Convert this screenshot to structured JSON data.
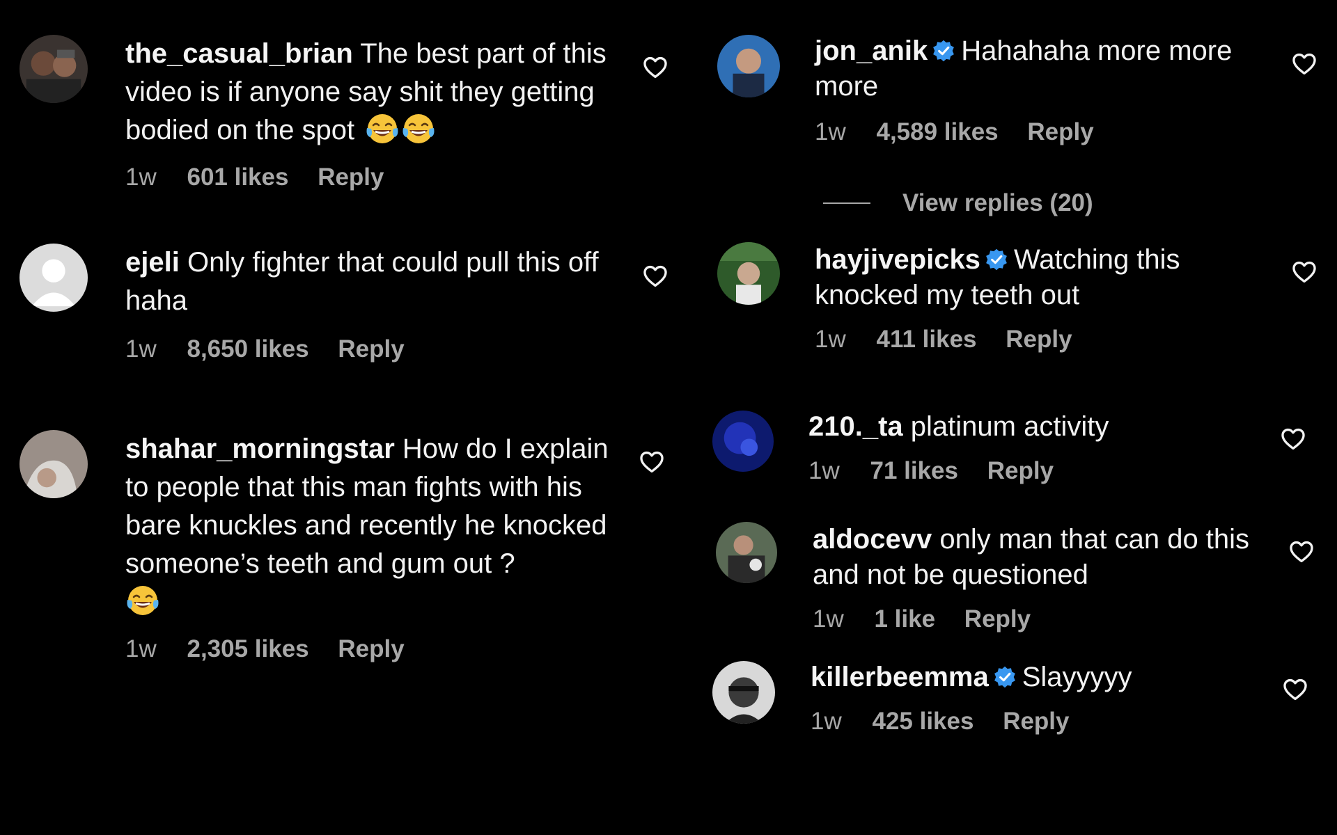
{
  "colors": {
    "background": "#000000",
    "text": "#f2f2f2",
    "meta": "#a8a8a8",
    "verified": "#3897f0"
  },
  "icons": {
    "like": "heart-outline-icon",
    "verified": "verified-badge-icon",
    "emoji": "face-with-tears-of-joy"
  },
  "comments": [
    {
      "username": "the_casual_brian",
      "verified": false,
      "text": "The best part of this video is if anyone say shit they getting bodied on the spot",
      "emoji_count": 2,
      "time": "1w",
      "likes": "601 likes",
      "reply": "Reply"
    },
    {
      "username": "ejeli",
      "verified": false,
      "text": "Only fighter that could pull this off haha",
      "emoji_count": 0,
      "time": "1w",
      "likes": "8,650 likes",
      "reply": "Reply"
    },
    {
      "username": "shahar_morningstar",
      "verified": false,
      "text": "How do I explain to people that this man fights with his bare knuckles and recently he knocked someone’s teeth and gum out ?",
      "emoji_count": 1,
      "time": "1w",
      "likes": "2,305 likes",
      "reply": "Reply"
    },
    {
      "username": "jon_anik",
      "verified": true,
      "text": "Hahahaha more more more",
      "emoji_count": 0,
      "time": "1w",
      "likes": "4,589 likes",
      "reply": "Reply"
    },
    {
      "username": "hayjivepicks",
      "verified": true,
      "text": "Watching this knocked my teeth out",
      "emoji_count": 0,
      "time": "1w",
      "likes": "411 likes",
      "reply": "Reply"
    },
    {
      "username": "210._ta",
      "verified": false,
      "text": "platinum activity",
      "emoji_count": 0,
      "time": "1w",
      "likes": "71 likes",
      "reply": "Reply"
    },
    {
      "username": "aldocevv",
      "verified": false,
      "text": "only man that can do this and not be questioned",
      "emoji_count": 0,
      "time": "1w",
      "likes": "1 like",
      "reply": "Reply"
    },
    {
      "username": "killerbeemma",
      "verified": true,
      "text": "Slayyyyy",
      "emoji_count": 0,
      "time": "1w",
      "likes": "425 likes",
      "reply": "Reply"
    }
  ],
  "view_replies": "View replies (20)"
}
